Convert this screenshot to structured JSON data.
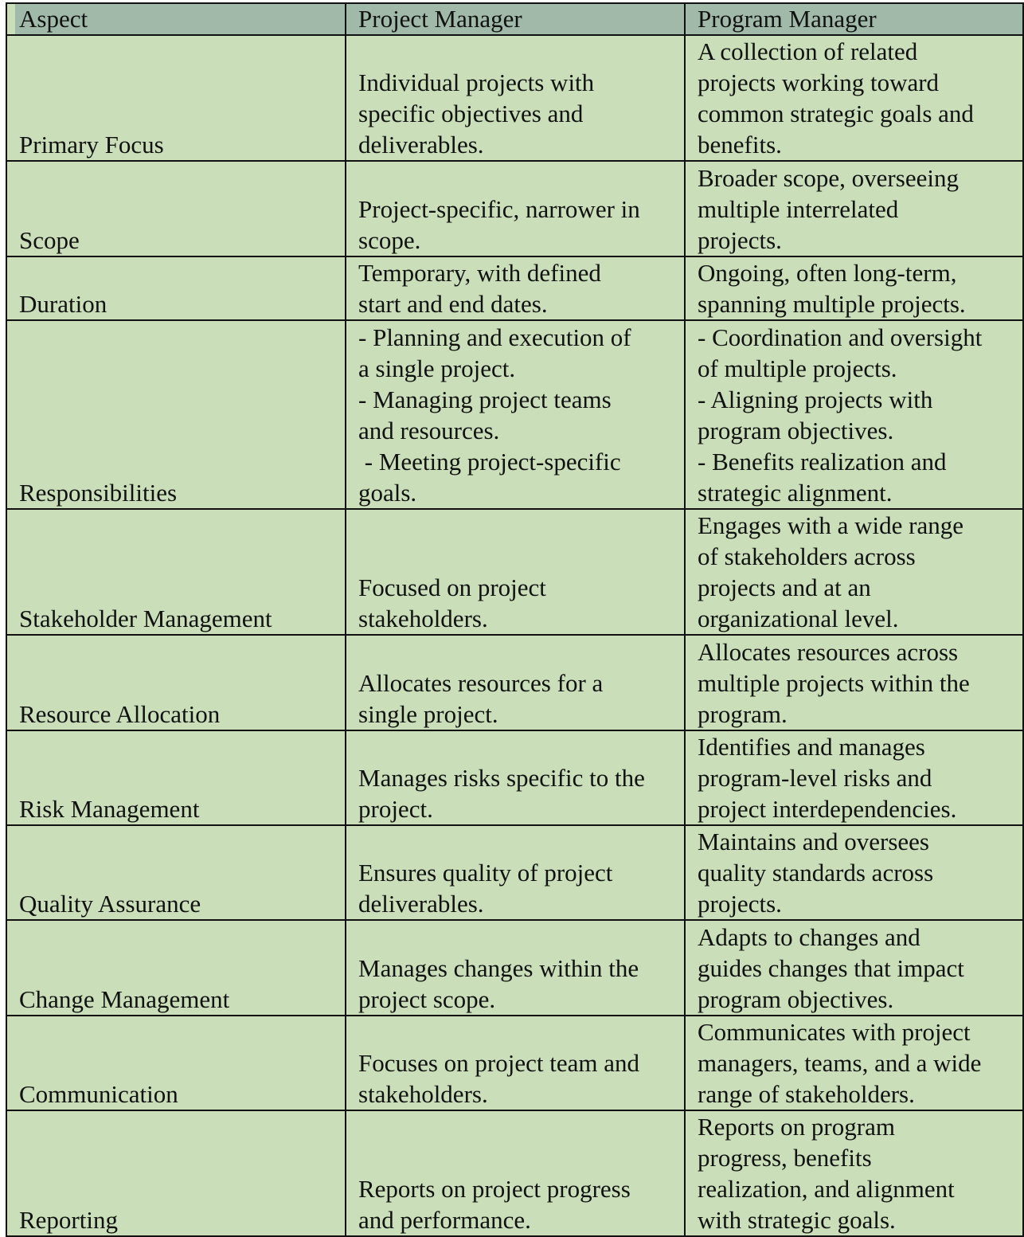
{
  "table": {
    "headers": [
      "Aspect",
      "Project Manager",
      "Program Manager"
    ],
    "rows": [
      {
        "aspect": "Primary Focus",
        "project": "Individual projects with\nspecific objectives and\ndeliverables.",
        "program": "A collection of related\nprojects working toward\ncommon strategic goals and\nbenefits."
      },
      {
        "aspect": "Scope",
        "project": "Project-specific, narrower in\nscope.",
        "program": "Broader scope, overseeing\nmultiple interrelated\nprojects."
      },
      {
        "aspect": "Duration",
        "project": "Temporary, with defined\nstart and end dates.",
        "program": "Ongoing, often long-term,\nspanning multiple projects."
      },
      {
        "aspect": "Responsibilities",
        "project": "- Planning and execution of\na single project.\n- Managing project teams\nand resources.\n - Meeting project-specific\ngoals.",
        "program": "- Coordination and oversight\nof multiple projects.\n- Aligning projects with\nprogram objectives.\n- Benefits realization and\nstrategic alignment."
      },
      {
        "aspect": "Stakeholder Management",
        "project": "Focused on project\nstakeholders.",
        "program": "Engages with a wide range\nof stakeholders across\nprojects and at an\norganizational level."
      },
      {
        "aspect": "Resource Allocation",
        "project": "Allocates resources for a\nsingle project.",
        "program": "Allocates resources across\nmultiple projects within the\nprogram."
      },
      {
        "aspect": "Risk Management",
        "project": "Manages risks specific to the\nproject.",
        "program": "Identifies and manages\nprogram-level risks and\nproject interdependencies."
      },
      {
        "aspect": "Quality Assurance",
        "project": "Ensures quality of project\ndeliverables.",
        "program": "Maintains and oversees\nquality standards across\nprojects."
      },
      {
        "aspect": "Change Management",
        "project": "Manages changes within the\nproject scope.",
        "program": "Adapts to changes and\nguides changes that impact\nprogram objectives."
      },
      {
        "aspect": "Communication",
        "project": "Focuses on project team and\nstakeholders.",
        "program": "Communicates with project\nmanagers, teams, and a wide\nrange of stakeholders."
      },
      {
        "aspect": "Reporting",
        "project": "Reports on project progress\nand performance.",
        "program": "Reports on program\nprogress, benefits\nrealization, and alignment\nwith strategic goals."
      }
    ]
  },
  "colors": {
    "header_bg": "#a0b9a9",
    "cell_bg": "#cadfb9",
    "border": "#111111"
  }
}
